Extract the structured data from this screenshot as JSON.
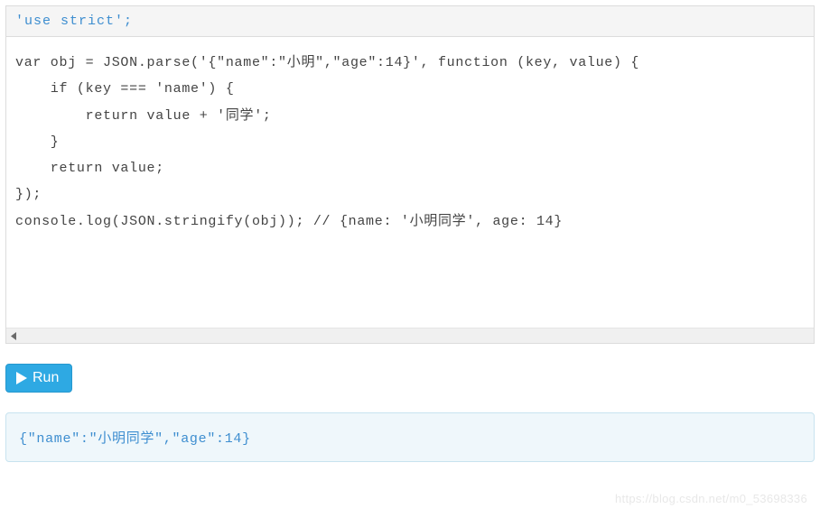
{
  "editor": {
    "strict_line": "'use strict';",
    "code_lines": [
      "var obj = JSON.parse('{\"name\":\"小明\",\"age\":14}', function (key, value) {",
      "    if (key === 'name') {",
      "        return value + '同学';",
      "    }",
      "    return value;",
      "});",
      "console.log(JSON.stringify(obj)); // {name: '小明同学', age: 14}"
    ]
  },
  "controls": {
    "run_label": "Run"
  },
  "output": {
    "text": "{\"name\":\"小明同学\",\"age\":14}"
  },
  "watermark": "https://blog.csdn.net/m0_53698336"
}
